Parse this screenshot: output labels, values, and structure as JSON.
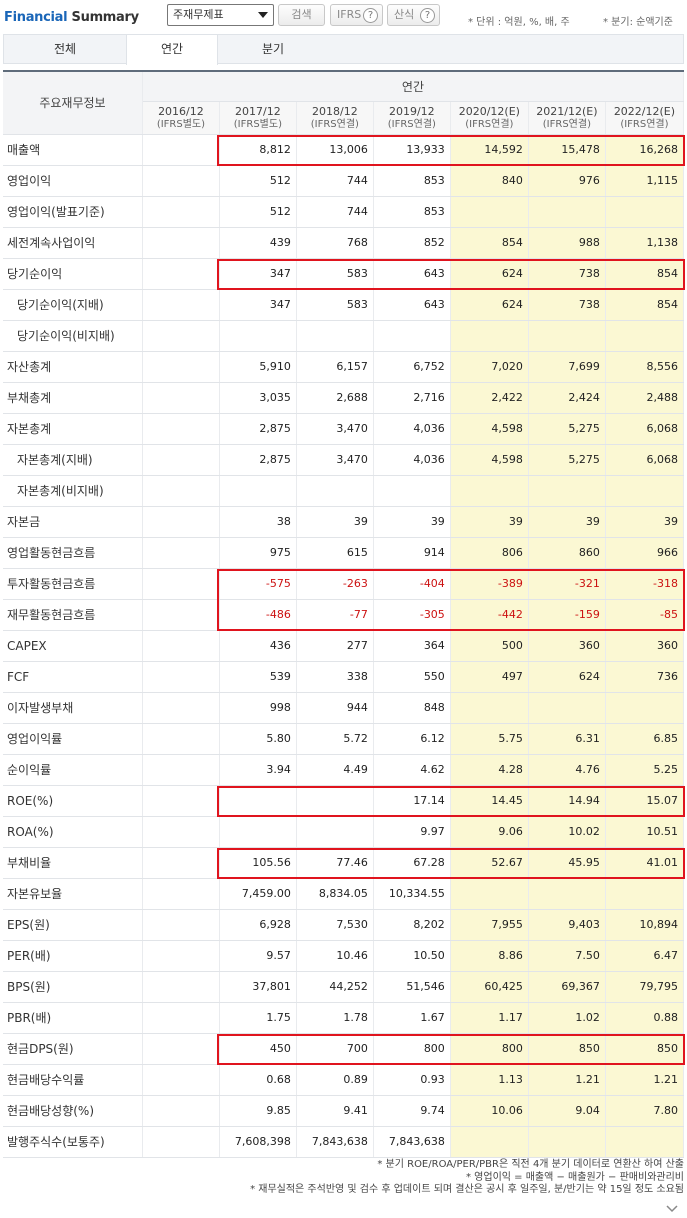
{
  "header": {
    "title_part1": "Financial",
    "title_part2": "Summary",
    "select_value": "주재무제표",
    "search_label": "검색",
    "ifrs_label": "IFRS",
    "calc_label": "산식",
    "help_icon": "question-circle-icon",
    "unit_note": "* 단위 : 억원, %, 배, 주",
    "basis_note": "* 분기: 순액기준"
  },
  "tabs": [
    {
      "label": "전체"
    },
    {
      "label": "연간"
    },
    {
      "label": "분기"
    }
  ],
  "table": {
    "row_header": "주요재무정보",
    "group_header": "연간",
    "columns": [
      {
        "year": "2016/12",
        "basis": "(IFRS별도)"
      },
      {
        "year": "2017/12",
        "basis": "(IFRS별도)"
      },
      {
        "year": "2018/12",
        "basis": "(IFRS연결)"
      },
      {
        "year": "2019/12",
        "basis": "(IFRS연결)"
      },
      {
        "year": "2020/12(E)",
        "basis": "(IFRS연결)"
      },
      {
        "year": "2021/12(E)",
        "basis": "(IFRS연결)"
      },
      {
        "year": "2022/12(E)",
        "basis": "(IFRS연결)"
      }
    ],
    "rows": [
      {
        "label": "매출액",
        "values": [
          "",
          "8,812",
          "13,006",
          "13,933",
          "14,592",
          "15,478",
          "16,268"
        ]
      },
      {
        "label": "영업이익",
        "values": [
          "",
          "512",
          "744",
          "853",
          "840",
          "976",
          "1,115"
        ]
      },
      {
        "label": "영업이익(발표기준)",
        "values": [
          "",
          "512",
          "744",
          "853",
          "",
          "",
          ""
        ]
      },
      {
        "label": "세전계속사업이익",
        "values": [
          "",
          "439",
          "768",
          "852",
          "854",
          "988",
          "1,138"
        ]
      },
      {
        "label": "당기순이익",
        "values": [
          "",
          "347",
          "583",
          "643",
          "624",
          "738",
          "854"
        ]
      },
      {
        "label": "당기순이익(지배)",
        "values": [
          "",
          "347",
          "583",
          "643",
          "624",
          "738",
          "854"
        ]
      },
      {
        "label": "당기순이익(비지배)",
        "values": [
          "",
          "",
          "",
          "",
          "",
          "",
          ""
        ]
      },
      {
        "label": "자산총계",
        "values": [
          "",
          "5,910",
          "6,157",
          "6,752",
          "7,020",
          "7,699",
          "8,556"
        ]
      },
      {
        "label": "부채총계",
        "values": [
          "",
          "3,035",
          "2,688",
          "2,716",
          "2,422",
          "2,424",
          "2,488"
        ]
      },
      {
        "label": "자본총계",
        "values": [
          "",
          "2,875",
          "3,470",
          "4,036",
          "4,598",
          "5,275",
          "6,068"
        ]
      },
      {
        "label": "자본총계(지배)",
        "values": [
          "",
          "2,875",
          "3,470",
          "4,036",
          "4,598",
          "5,275",
          "6,068"
        ]
      },
      {
        "label": "자본총계(비지배)",
        "values": [
          "",
          "",
          "",
          "",
          "",
          "",
          ""
        ]
      },
      {
        "label": "자본금",
        "values": [
          "",
          "38",
          "39",
          "39",
          "39",
          "39",
          "39"
        ]
      },
      {
        "label": "영업활동현금흐름",
        "values": [
          "",
          "975",
          "615",
          "914",
          "806",
          "860",
          "966"
        ]
      },
      {
        "label": "투자활동현금흐름",
        "values": [
          "",
          "-575",
          "-263",
          "-404",
          "-389",
          "-321",
          "-318"
        ]
      },
      {
        "label": "재무활동현금흐름",
        "values": [
          "",
          "-486",
          "-77",
          "-305",
          "-442",
          "-159",
          "-85"
        ]
      },
      {
        "label": "CAPEX",
        "values": [
          "",
          "436",
          "277",
          "364",
          "500",
          "360",
          "360"
        ]
      },
      {
        "label": "FCF",
        "values": [
          "",
          "539",
          "338",
          "550",
          "497",
          "624",
          "736"
        ]
      },
      {
        "label": "이자발생부채",
        "values": [
          "",
          "998",
          "944",
          "848",
          "",
          "",
          ""
        ]
      },
      {
        "label": "영업이익률",
        "values": [
          "",
          "5.80",
          "5.72",
          "6.12",
          "5.75",
          "6.31",
          "6.85"
        ]
      },
      {
        "label": "순이익률",
        "values": [
          "",
          "3.94",
          "4.49",
          "4.62",
          "4.28",
          "4.76",
          "5.25"
        ]
      },
      {
        "label": "ROE(%)",
        "values": [
          "",
          "",
          "",
          "17.14",
          "14.45",
          "14.94",
          "15.07"
        ]
      },
      {
        "label": "ROA(%)",
        "values": [
          "",
          "",
          "",
          "9.97",
          "9.06",
          "10.02",
          "10.51"
        ]
      },
      {
        "label": "부채비율",
        "values": [
          "",
          "105.56",
          "77.46",
          "67.28",
          "52.67",
          "45.95",
          "41.01"
        ]
      },
      {
        "label": "자본유보율",
        "values": [
          "",
          "7,459.00",
          "8,834.05",
          "10,334.55",
          "",
          "",
          ""
        ]
      },
      {
        "label": "EPS(원)",
        "values": [
          "",
          "6,928",
          "7,530",
          "8,202",
          "7,955",
          "9,403",
          "10,894"
        ]
      },
      {
        "label": "PER(배)",
        "values": [
          "",
          "9.57",
          "10.46",
          "10.50",
          "8.86",
          "7.50",
          "6.47"
        ]
      },
      {
        "label": "BPS(원)",
        "values": [
          "",
          "37,801",
          "44,252",
          "51,546",
          "60,425",
          "69,367",
          "79,795"
        ]
      },
      {
        "label": "PBR(배)",
        "values": [
          "",
          "1.75",
          "1.78",
          "1.67",
          "1.17",
          "1.02",
          "0.88"
        ]
      },
      {
        "label": "현금DPS(원)",
        "values": [
          "",
          "450",
          "700",
          "800",
          "800",
          "850",
          "850"
        ]
      },
      {
        "label": "현금배당수익률",
        "values": [
          "",
          "0.68",
          "0.89",
          "0.93",
          "1.13",
          "1.21",
          "1.21"
        ]
      },
      {
        "label": "현금배당성향(%)",
        "values": [
          "",
          "9.85",
          "9.41",
          "9.74",
          "10.06",
          "9.04",
          "7.80"
        ]
      },
      {
        "label": "발행주식수(보통주)",
        "values": [
          "",
          "7,608,398",
          "7,843,638",
          "7,843,638",
          "",
          "",
          ""
        ]
      }
    ]
  },
  "footnotes": [
    "* 분기 ROE/ROA/PER/PBR은 직전 4개 분기 데이터로 연환산 하여 산출",
    "* 영업이익 = 매출액 − 매출원가 − 판매비와관리비",
    "* 재무실적은 주석반영 및 검수 후 업데이트 되며 결산은 공시 후 일주일, 분/반기는 약 15일 정도 소요됨"
  ],
  "colors": {
    "title_blue": "#1a66b8",
    "estimate_bg": "#fbf8d3",
    "negative": "#cc1111",
    "highlight_box": "#e0141e"
  }
}
